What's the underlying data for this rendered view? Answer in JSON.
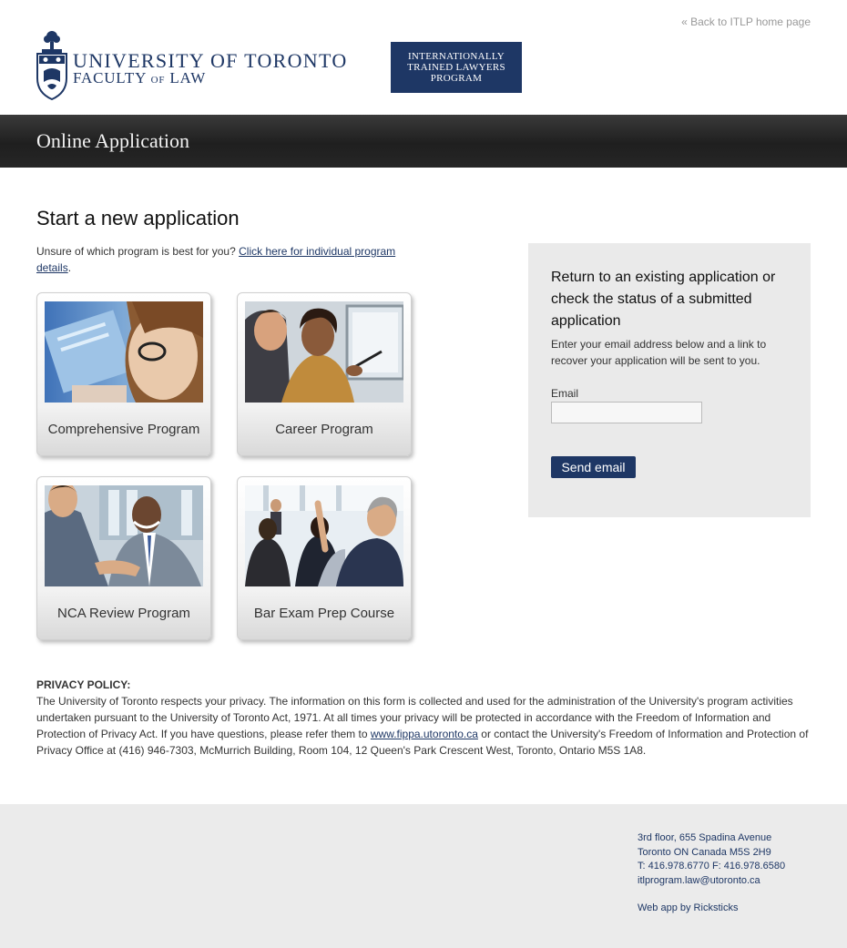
{
  "header": {
    "back_link": "« Back to ITLP home page",
    "logo_line1": "UNIVERSITY OF TORONTO",
    "logo_line2_a": "FACULTY",
    "logo_line2_b": "OF",
    "logo_line2_c": "LAW",
    "badge_line1": "INTERNATIONALLY",
    "badge_line2": "TRAINED LAWYERS",
    "badge_line3": "PROGRAM"
  },
  "banner": {
    "title": "Online Application"
  },
  "main": {
    "title": "Start a new application",
    "intro_text": "Unsure of which program is best for you? ",
    "intro_link": "Click here for individual program details",
    "intro_end": ".",
    "programs": [
      {
        "label": "Comprehensive Program",
        "image": "woman-at-laptop-photo"
      },
      {
        "label": "Career Program",
        "image": "colleagues-at-monitor-photo"
      },
      {
        "label": "NCA Review Program",
        "image": "handshake-photo"
      },
      {
        "label": "Bar Exam Prep Course",
        "image": "classroom-photo"
      }
    ]
  },
  "panel": {
    "title": "Return to an existing application or check the status of a submitted application",
    "description": "Enter your email address below and a link to recover your application will be sent to you.",
    "email_label": "Email",
    "email_value": "",
    "email_placeholder": "",
    "send_label": "Send email"
  },
  "privacy": {
    "heading": "PRIVACY POLICY:",
    "text_before_link": "The University of Toronto respects your privacy. The information on this form is collected and used for the administration of the University's program activities undertaken pursuant to the University of Toronto Act, 1971. At all times your privacy will be protected in accordance with the Freedom of Information and Protection of Privacy Act. If you have questions, please refer them to ",
    "link": "www.fippa.utoronto.ca",
    "text_after_link": " or contact the University's Freedom of Information and Protection of Privacy Office at (416) 946-7303, McMurrich Building, Room 104, 12 Queen's Park Crescent West, Toronto, Ontario M5S 1A8."
  },
  "footer": {
    "address1": "3rd floor, 655 Spadina Avenue",
    "address2": "Toronto ON Canada M5S 2H9",
    "phone": "T: 416.978.6770 F: 416.978.6580",
    "email": "itlprogram.law@utoronto.ca",
    "credit": "Web app by Ricksticks"
  },
  "colors": {
    "brand_navy": "#1e3765",
    "banner_dark": "#262626",
    "panel_gray": "#eaeaea",
    "footer_gray": "#ebebeb"
  }
}
